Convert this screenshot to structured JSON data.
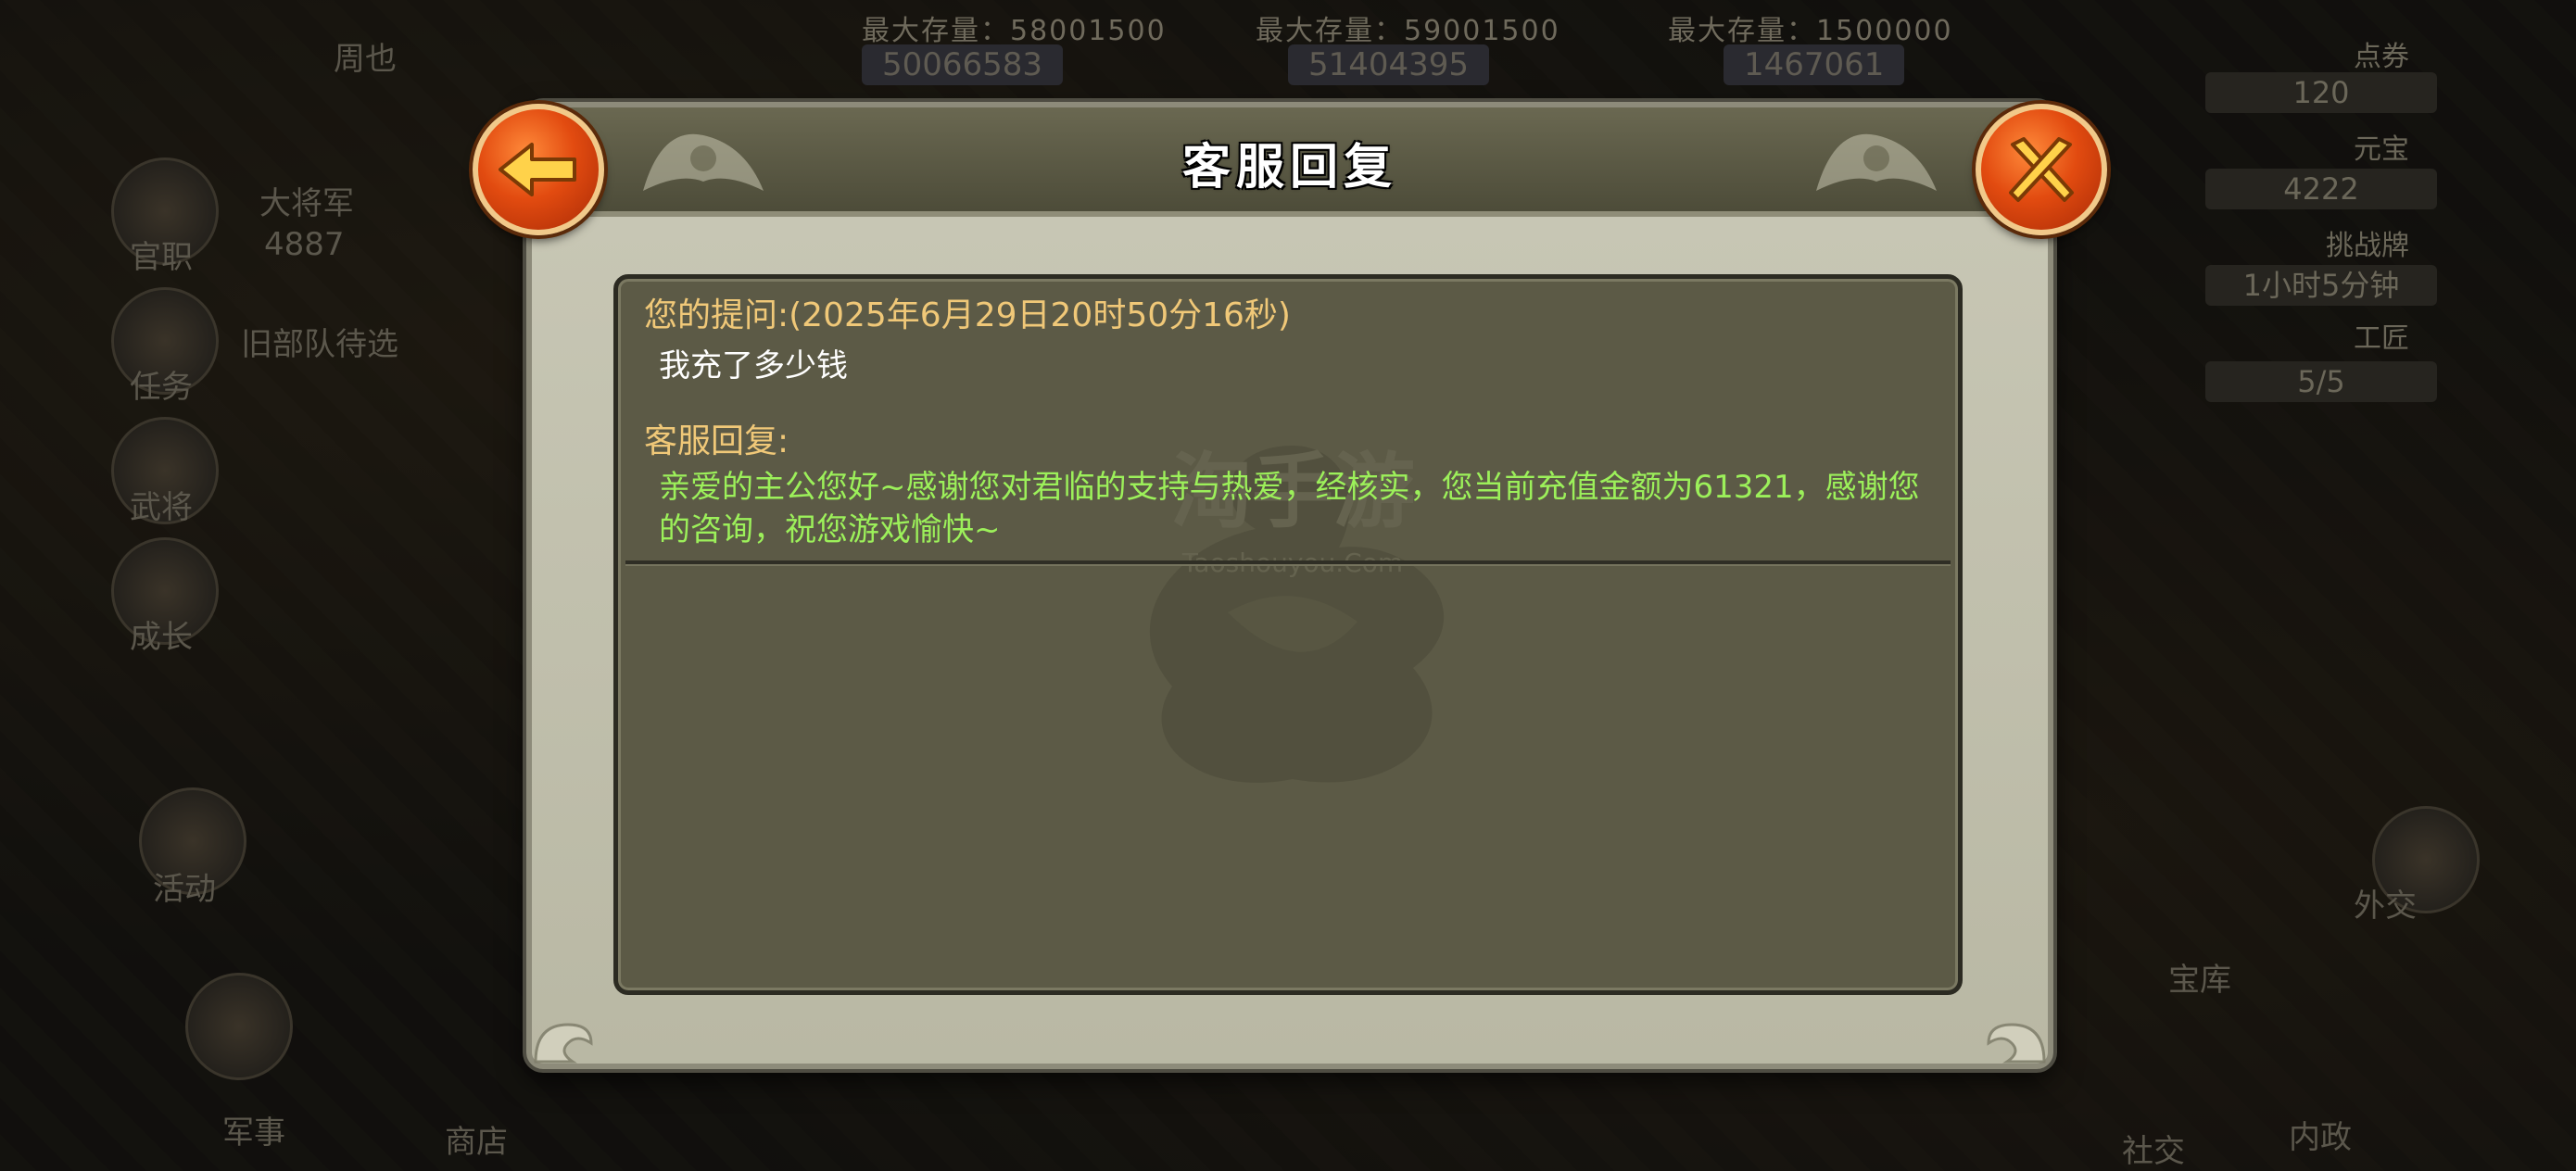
{
  "dialog": {
    "title": "客服回复",
    "back_icon": "left-arrow-icon",
    "close_icon": "crossed-swords-close-icon",
    "question_label": "您的提问:(2025年6月29日20时50分16秒)",
    "question_text": "我充了多少钱",
    "reply_label": "客服回复:",
    "reply_text": "亲爱的主公您好~感谢您对君临的支持与热爱，经核实，您当前充值金额为61321，感谢您的咨询，祝您游戏愉快~"
  },
  "watermark": {
    "brand": "淘手游",
    "site": "Taoshouyou.Com"
  },
  "background": {
    "top_stats": [
      {
        "label": "最大存量：58001500",
        "value": "50066583"
      },
      {
        "label": "最大存量：59001500",
        "value": "51404395"
      },
      {
        "label": "最大存量：1500000",
        "value": "1467061"
      }
    ],
    "left_menu": [
      "周也",
      "官职",
      "任务",
      "武将",
      "成长",
      "活动",
      "军事",
      "商店"
    ],
    "left_extra": [
      "大将军",
      "4887",
      "旧部队待选"
    ],
    "right_stats": [
      {
        "label": "点券",
        "value": "120"
      },
      {
        "label": "元宝",
        "value": "4222"
      },
      {
        "label": "挑战牌",
        "value": "1小时5分钟"
      },
      {
        "label": "工匠",
        "value": "5/5"
      }
    ],
    "right_menu": [
      "宝库",
      "内政",
      "社交",
      "外交"
    ]
  }
}
